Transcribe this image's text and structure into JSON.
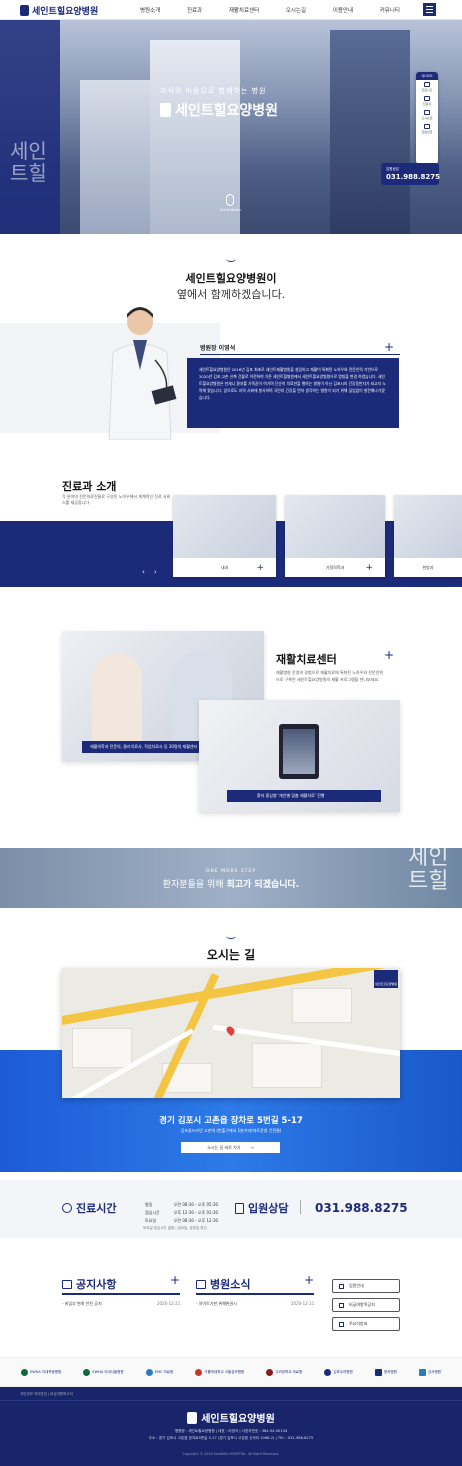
{
  "header": {
    "logo_text": "세인트힐요양병원",
    "nav": [
      "병원소개",
      "진료과",
      "재활치료센터",
      "오시는길",
      "이용안내",
      "커뮤니티"
    ]
  },
  "hero": {
    "subtitle": "자식의 마음으로 함께하는 병원",
    "title": "세인트힐요양병원",
    "side_text_1": "세인",
    "side_text_2": "트힐",
    "scroll_text": "Scroll Down",
    "quick_menu": {
      "title": "QUICK",
      "items": [
        "진료시간",
        "진료과",
        "오시는길",
        "입원상담"
      ]
    },
    "call": {
      "label": "입원상담",
      "number": "031.988.8275"
    }
  },
  "intro": {
    "title_line1": "세인트힐요양병원이",
    "title_line2": "옆에서 함께하겠습니다.",
    "director_heading": "병원장 이영석",
    "director_text": "세인트힐요양병원은 2016년 김포 최초로 세인트재활병원을 설립하고 재활이 특화된 노하우와 전문인력 기반으로 2020년 김포 고촌 신축 건물로 이전하여 기존 세인트힐병원에서 세인트힐요양병원으로 명칭을 변경 하였습니다. 세인트힐요양병원은 만세니 환자를 가족같이 여기며 단순히 치료만을 행하는 병원이 아닌 김포시의 건강동반자가 되고자 노력해 왔습니다. 앞으로도 지역 사회에 봉사하며 국민의 건강을 먼저 생각하는 병원이 되기 위해 끊임없이 발전해나가겠습니다."
  },
  "departments": {
    "title": "진료과 소개",
    "desc": "각 분야의 전문의료진들로 구성된 노하우에서 체계적인 진료 서비스를 제공합니다.",
    "cards": [
      "내과",
      "가정의학과",
      "한방과"
    ],
    "prev": "‹",
    "next": "›"
  },
  "rehab": {
    "title": "재활치료센터",
    "desc": "재활병원 운영의 경험으로 재활치료에 특화된 노하우와 전문인력으로 구축된 세인트힐요양병원의 재활 프로그램을 만나보세요.",
    "caption1": "재활의학과 전문의, 물리치료사, 작업치료사 등 30명의 재활센터 치료 전문가들",
    "caption2": "환자 중심형 '개인별 맞춤 재활치료' 진행"
  },
  "banner": {
    "small": "ONE MORE STEP",
    "main_prefix": "환자분들을 위해 ",
    "main_bold": "최고가 되겠습니다.",
    "deco_1": "세인",
    "deco_2": "트힐"
  },
  "directions": {
    "title": "오시는 길",
    "map_logo": "세인트힐요양병원",
    "address": "경기 김포시 고촌읍 장차로 5번길 5-17",
    "address_sub": "김포골드라인 고촌역 (번출구에서 1분거리(마트운영 건전물)",
    "button": "오시는 길 바로 가기",
    "button_arrow": "→"
  },
  "hours": {
    "title": "진료시간",
    "rows": [
      {
        "day": "평일",
        "time": "오전 08:30 - 오후 05:30"
      },
      {
        "day": "점심시간",
        "time": "오후 12:30 - 오후 01:30"
      },
      {
        "day": "토요일",
        "time": "오전 08:30 - 오후 12:30"
      }
    ],
    "note": "토요일 점심시간 없음 | 일요일, 공휴일 휴진",
    "inquiry_title": "입원상담",
    "inquiry_phone": "031.988.8275"
  },
  "board": {
    "notice_title": "공지사항",
    "notice_row": "- 비임부 변화 안된 공지",
    "notice_date": "2020-12-21",
    "news_title": "병원소식",
    "news_row": "- 차이트기판 위해한권시",
    "news_date": "2020-12-21",
    "quick_buttons": [
      "입원안내",
      "비급여항목공지",
      "주요석방표"
    ]
  },
  "partners": [
    "EWHA 이대목동병원",
    "EWHA 이대서울병원",
    "EMC 의료원",
    "가톨릭대학교 서울성모병원",
    "고려대학교 의료원",
    "김포우리병원",
    "명지병원",
    "강서병원",
    "한국장애인 협회",
    "닥터힐 명지병원"
  ],
  "footer": {
    "links": "개인정보 처리방침   |   비급여항목고지",
    "logo_text": "세인트힐요양병원",
    "info1": "병원명 : 세인트힐요양병원   |   대표 : 이영석   |   사업자번호 : 384-94-00134",
    "info2": "주소 : 경기 김포시 고촌읍 장차로5번길 5-17 (경기 김포시 고촌읍 신곡리 1068-2)   |   TEL : 031-988-8275",
    "copyright": "Copyright © 2020 SaintHills HOSPITAL. All Right Reserved."
  },
  "colors": {
    "navy": "#1c2a7a",
    "blue": "#1d5bd6"
  }
}
